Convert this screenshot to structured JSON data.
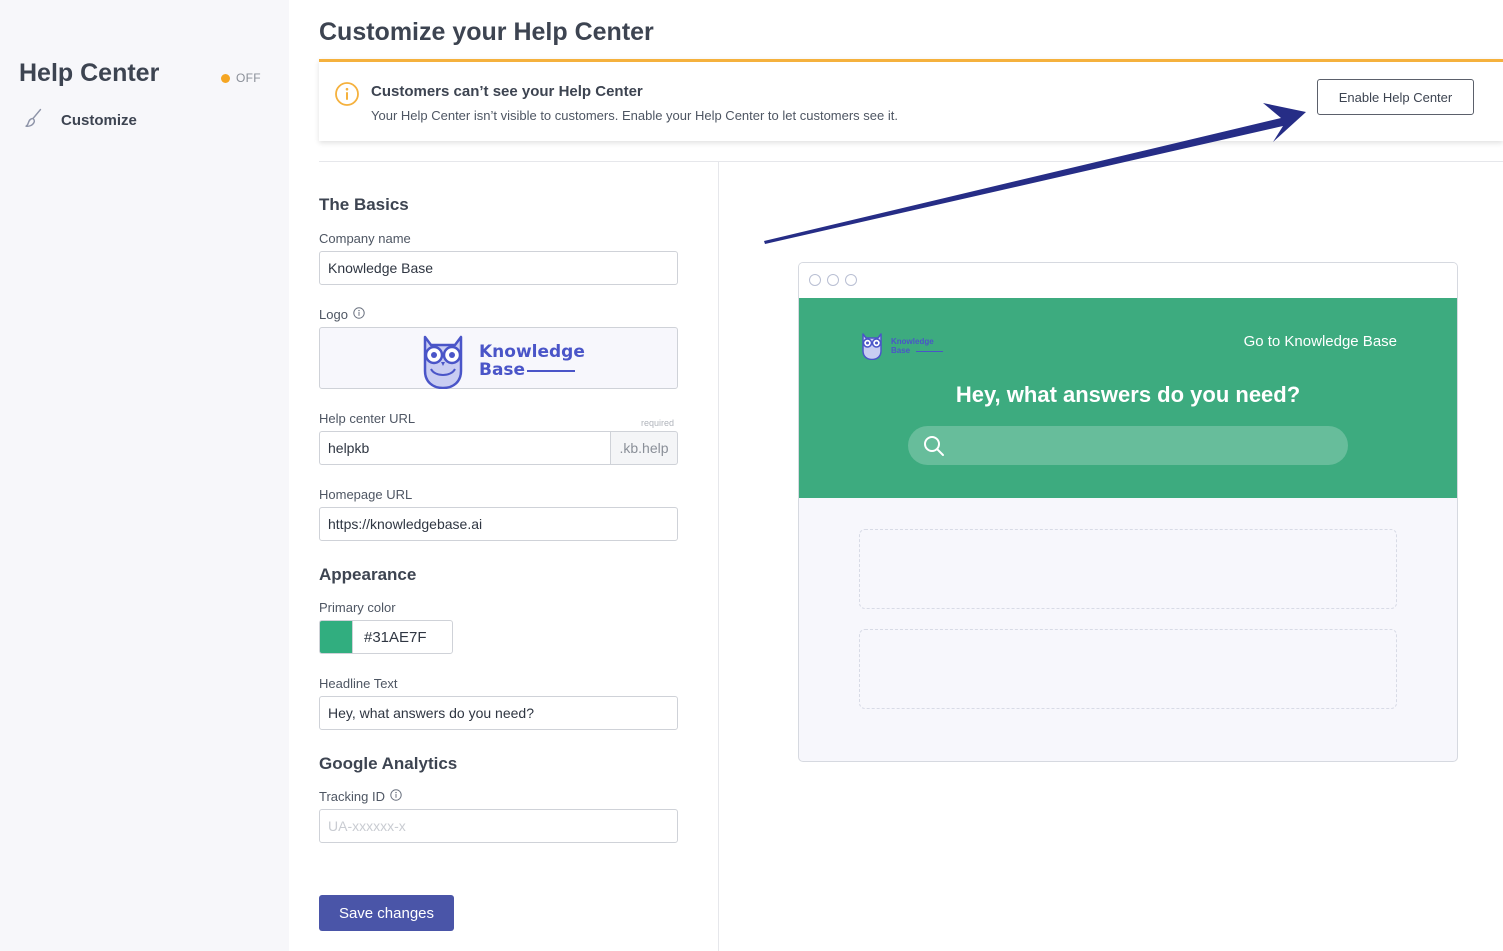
{
  "sidebar": {
    "title": "Help Center",
    "status": "OFF",
    "status_color": "#f5a623",
    "nav_item_icon": "paintbrush-icon",
    "nav_item_label": "Customize"
  },
  "page_title": "Customize your Help Center",
  "alert": {
    "icon": "info-icon",
    "title": "Customers can’t see your Help Center",
    "text": "Your Help Center isn’t visible to customers. Enable your Help Center to let customers see it.",
    "button_label": "Enable Help Center",
    "accent_color": "#f5b13d"
  },
  "form": {
    "basics_title": "The Basics",
    "company_name_label": "Company name",
    "company_name_value": "Knowledge Base",
    "logo_label": "Logo",
    "logo_text_line1": "Knowledge",
    "logo_text_line2": "Base",
    "help_url_label": "Help center URL",
    "help_url_required": "required",
    "help_url_value": "helpkb",
    "help_url_suffix": ".kb.help",
    "homepage_url_label": "Homepage URL",
    "homepage_url_value": "https://knowledgebase.ai",
    "appearance_title": "Appearance",
    "primary_color_label": "Primary color",
    "primary_color_value": "#31AE7F",
    "headline_label": "Headline Text",
    "headline_value": "Hey, what answers do you need?",
    "analytics_title": "Google Analytics",
    "tracking_label": "Tracking ID",
    "tracking_placeholder": "UA-xxxxxx-x",
    "save_label": "Save changes"
  },
  "preview": {
    "logo_line1": "Knowledge",
    "logo_line2": "Base",
    "link_label": "Go to Knowledge Base",
    "headline": "Hey, what answers do you need?",
    "hero_color": "#3dab7f"
  },
  "colors": {
    "brand": "#4a55a8",
    "annotation_arrow": "#262d86"
  }
}
